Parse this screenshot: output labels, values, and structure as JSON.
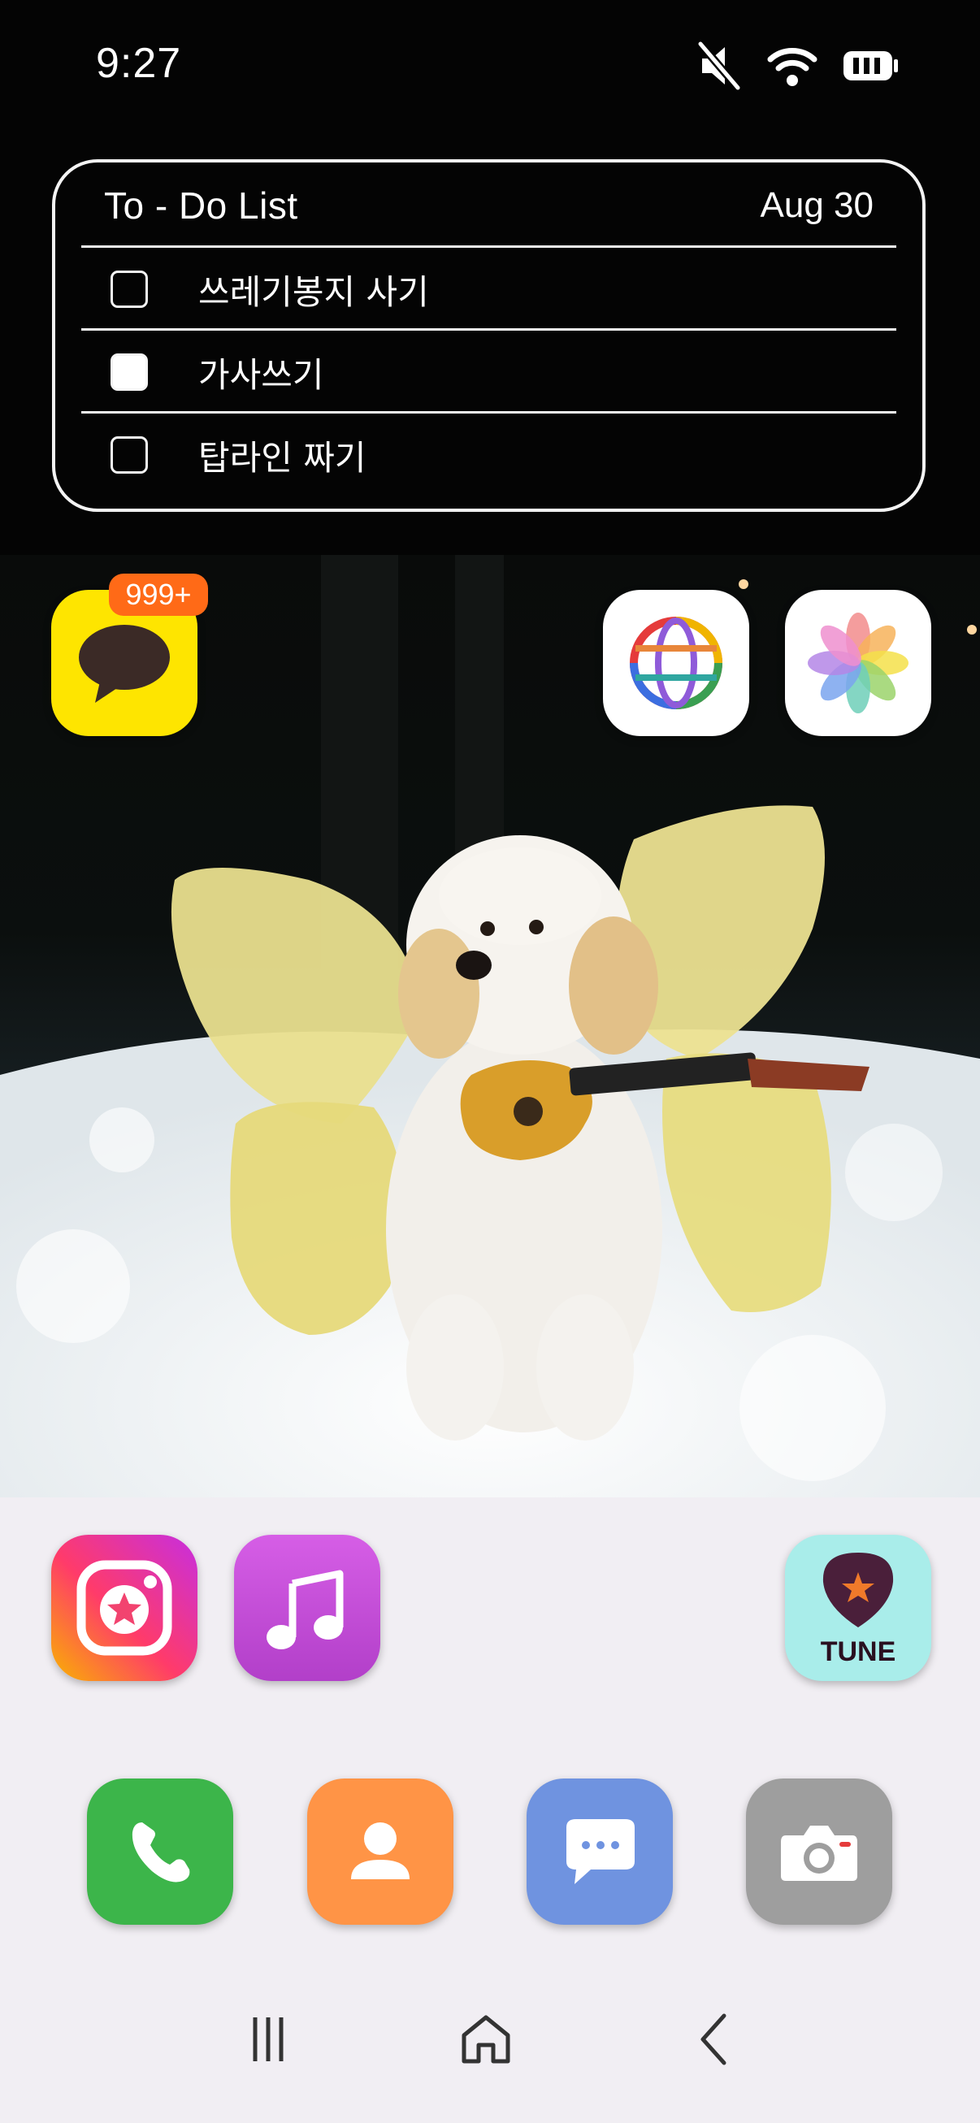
{
  "status_bar": {
    "time": "9:27",
    "icons": [
      "mute-icon",
      "wifi-icon",
      "battery-icon"
    ]
  },
  "todo_widget": {
    "title": "To - Do List",
    "date": "Aug 30",
    "items": [
      {
        "label": "쓰레기봉지 사기",
        "checked": false
      },
      {
        "label": "가사쓰기",
        "checked": true
      },
      {
        "label": "탑라인 짜기",
        "checked": false
      }
    ]
  },
  "home_apps": {
    "kakaotalk": {
      "icon": "chat-bubble-icon",
      "badge": "999+",
      "color": "#FEE500"
    },
    "browser": {
      "icon": "globe-icon"
    },
    "gallery": {
      "icon": "flower-icon"
    }
  },
  "lower_apps": {
    "star_app": {
      "icon": "star-icon"
    },
    "music": {
      "icon": "music-note-icon"
    },
    "tune": {
      "icon": "guitar-pick-icon",
      "label": "TUNE"
    }
  },
  "dock": [
    "phone-icon",
    "contacts-icon",
    "messages-icon",
    "camera-icon"
  ],
  "nav_bar": [
    "recents-icon",
    "home-icon",
    "back-icon"
  ],
  "colors": {
    "kakao": "#FEE500",
    "badge": "#FF6A17",
    "phone": "#3CB54A",
    "contacts": "#FF9446",
    "messages": "#6F93E0",
    "camera": "#9E9E9E",
    "music": "#C94CDB",
    "tune": "#A9EDEA"
  }
}
